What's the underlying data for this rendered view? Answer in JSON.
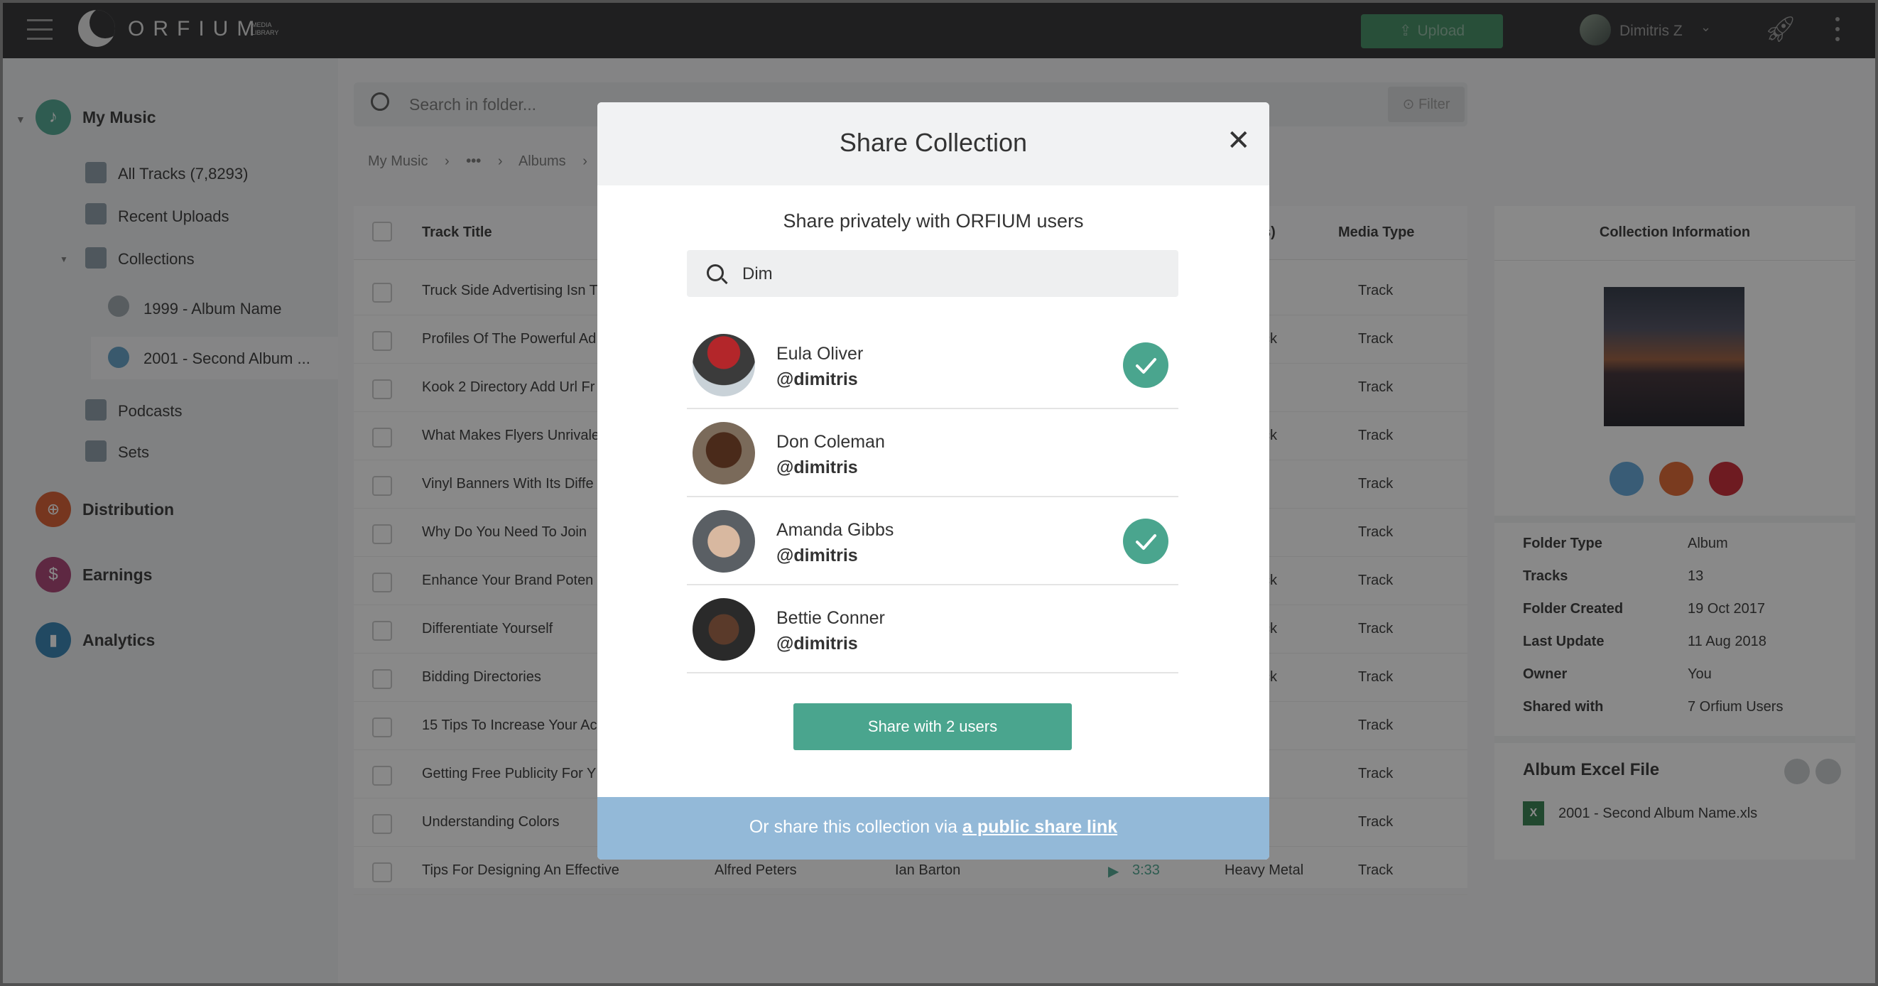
{
  "app": {
    "logo_text": "ORFIUM",
    "logo_sub_1": "MEDIA",
    "logo_sub_2": "LIBRARY",
    "upload_label": "Upload",
    "user_name": "Dimitris Z"
  },
  "sidebar": {
    "my_music": "My Music",
    "items": [
      {
        "label": "All Tracks (7,8293)"
      },
      {
        "label": "Recent Uploads"
      },
      {
        "label": "Collections"
      },
      {
        "label": "1999 - Album Name"
      },
      {
        "label": "2001 - Second Album ..."
      },
      {
        "label": "Podcasts"
      },
      {
        "label": "Sets"
      }
    ],
    "distribution": "Distribution",
    "earnings": "Earnings",
    "analytics": "Analytics"
  },
  "main": {
    "search_placeholder": "Search in folder...",
    "filter_label": "Filter",
    "breadcrumb": [
      "My Music",
      "•••",
      "Albums"
    ],
    "columns": {
      "title": "Track Title",
      "s": "s)",
      "media": "Media Type"
    },
    "rows": [
      {
        "title": "Truck Side Advertising Isn T",
        "mid": "",
        "media": "Track"
      },
      {
        "title": "Profiles Of The Powerful Ad",
        "mid": "ck",
        "media": "Track"
      },
      {
        "title": "Kook 2 Directory Add Url Fr",
        "mid": "",
        "media": "Track"
      },
      {
        "title": "What Makes Flyers Unrivale",
        "mid": "ck",
        "media": "Track"
      },
      {
        "title": "Vinyl Banners With Its Diffe",
        "mid": "",
        "media": "Track"
      },
      {
        "title": "Why Do You Need To Join",
        "mid": "",
        "media": "Track"
      },
      {
        "title": "Enhance Your Brand Poten",
        "mid": "ck",
        "media": "Track"
      },
      {
        "title": "Differentiate Yourself",
        "mid": "ck",
        "media": "Track"
      },
      {
        "title": "Bidding Directories",
        "mid": "ck",
        "media": "Track"
      },
      {
        "title": "15 Tips To Increase Your Ac",
        "mid": "",
        "media": "Track"
      },
      {
        "title": "Getting Free Publicity For Y",
        "mid": "",
        "media": "Track"
      },
      {
        "title": "Understanding Colors",
        "mid": "",
        "media": "Track"
      }
    ],
    "last_row": {
      "title": "Tips For Designing An Effective",
      "artist": "Alfred Peters",
      "composer": "Ian Barton",
      "duration": "3:33",
      "genre": "Heavy Metal",
      "media": "Track"
    }
  },
  "info": {
    "header": "Collection Information",
    "rows": [
      {
        "label": "Folder Type",
        "value": "Album"
      },
      {
        "label": "Tracks",
        "value": "13"
      },
      {
        "label": "Folder Created",
        "value": "19 Oct 2017"
      },
      {
        "label": "Last Update",
        "value": "11 Aug 2018"
      },
      {
        "label": "Owner",
        "value": "You"
      },
      {
        "label": "Shared with",
        "value": "7  Orfium Users"
      }
    ],
    "excel_title": "Album Excel File",
    "excel_file": "2001 - Second Album Name.xls"
  },
  "modal": {
    "title": "Share Collection",
    "subtitle": "Share privately with ORFIUM users",
    "search_value": "Dim",
    "users": [
      {
        "name": "Eula Oliver",
        "handle": "@dimitris",
        "selected": true
      },
      {
        "name": "Don Coleman",
        "handle": "@dimitris",
        "selected": false
      },
      {
        "name": "Amanda Gibbs",
        "handle": "@dimitris",
        "selected": true
      },
      {
        "name": "Bettie Conner",
        "handle": "@dimitris",
        "selected": false
      }
    ],
    "share_button": "Share with 2 users",
    "footer_prefix": "Or share this collection via",
    "footer_link": "a public share link"
  },
  "colors": {
    "accent": "#4aa58e",
    "footer": "#93b9d8",
    "topbar": "#2a2b2c"
  }
}
